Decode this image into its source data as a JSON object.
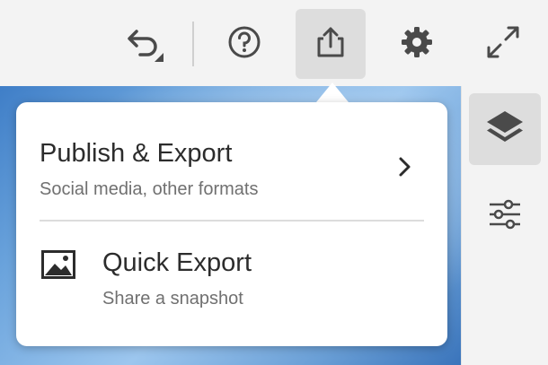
{
  "toolbar": {
    "undo_icon": "undo-icon",
    "help_icon": "help-icon",
    "share_icon": "share-export-icon",
    "settings_icon": "gear-icon",
    "fullscreen_icon": "expand-icon"
  },
  "export_menu": {
    "items": [
      {
        "title": "Publish & Export",
        "subtitle": "Social media, other formats",
        "icon": "chevron-right-icon"
      },
      {
        "title": "Quick Export",
        "subtitle": "Share a snapshot",
        "icon": "image-icon"
      }
    ]
  },
  "right_panel": {
    "layers_icon": "layers-icon",
    "adjustments_icon": "sliders-icon"
  },
  "colors": {
    "icon": "#4a4a4a",
    "active_bg": "#dddddd",
    "toolbar_bg": "#f3f3f3",
    "canvas_blue": "#6aa3dc"
  }
}
